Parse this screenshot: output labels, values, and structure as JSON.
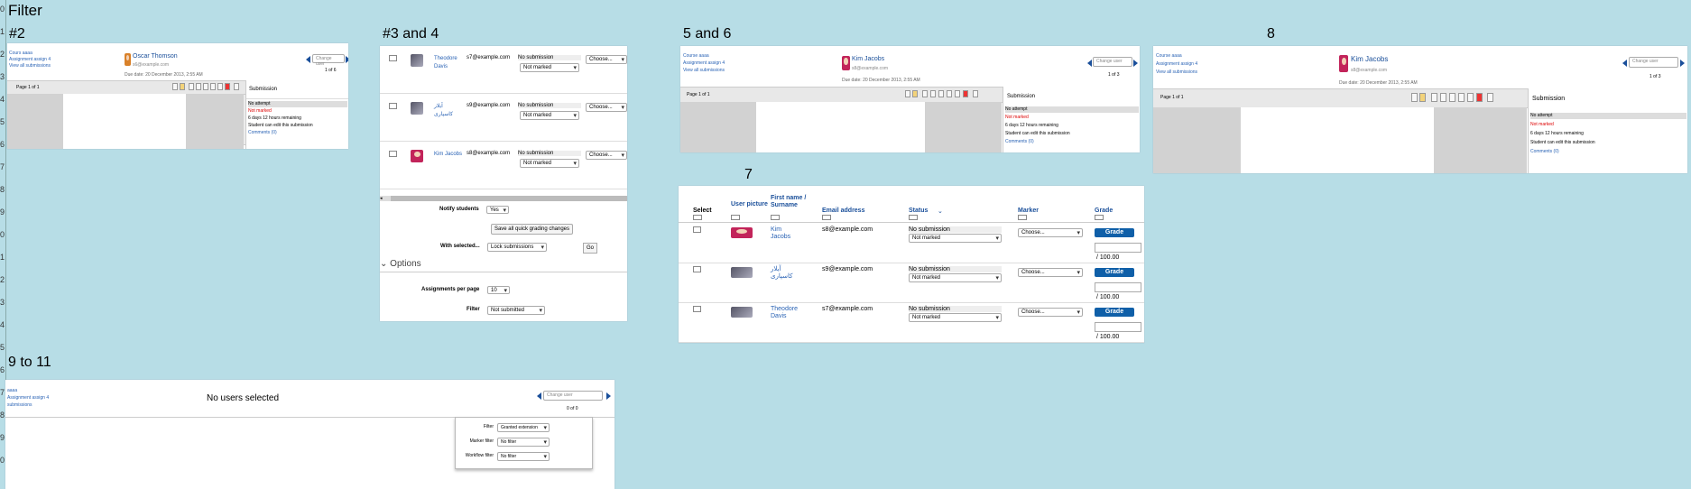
{
  "title": "Filter",
  "labels": {
    "p2": "#2",
    "p34": "#3 and 4",
    "p56": "5 and 6",
    "p8": "8",
    "p7": "7",
    "p911": "9 to 11"
  },
  "gutter_numbers": [
    "0",
    "1",
    "2",
    "3",
    "4",
    "5",
    "6",
    "7",
    "8",
    "9",
    "0",
    "1",
    "2",
    "3",
    "4",
    "5",
    "6",
    "7",
    "8",
    "9",
    "0"
  ],
  "grader_small": {
    "back_links": [
      "Cours aaaa",
      "Assignment assign 4",
      "View all submissions"
    ],
    "user_name": "Oscar Thomson",
    "user_email": "s6@example.com",
    "due": "Due date: 20 December 2013, 2:55 AM",
    "change_user": "Change user",
    "count": "1 of 6",
    "page": "Page 1 of 1",
    "submission_title": "Submission",
    "status": [
      "No attempt",
      "Not marked",
      "6 days 12 hours remaining",
      "Student can edit this submission",
      "Comments (0)"
    ]
  },
  "grader_kim": {
    "back_links": [
      "Course aaaa",
      "Assignment assign 4",
      "View all submissions"
    ],
    "user_name": "Kim Jacobs",
    "user_email": "s8@example.com",
    "due": "Due date: 20 December 2013, 2:55 AM",
    "change_user": "Change user",
    "count": "1 of 3",
    "page": "Page 1 of 1",
    "submission_title": "Submission",
    "status": [
      "No attempt",
      "Not marked",
      "6 days 12 hours remaining",
      "Student can edit this submission",
      "Comments (0)"
    ]
  },
  "table34": {
    "rows": [
      {
        "name": "Theodore Davis",
        "email": "s7@example.com",
        "status": "No submission",
        "grading": "Not marked",
        "marker": "Choose..."
      },
      {
        "name": "آیلار کاسپاری",
        "email": "s9@example.com",
        "status": "No submission",
        "grading": "Not marked",
        "marker": "Choose..."
      },
      {
        "name": "Kim Jacobs",
        "email": "s8@example.com",
        "status": "No submission",
        "grading": "Not marked",
        "marker": "Choose..."
      }
    ],
    "notify_label": "Notify students",
    "notify_value": "Yes",
    "save_button": "Save all quick grading changes",
    "with_selected_label": "With selected...",
    "with_selected_value": "Lock submissions",
    "go_button": "Go",
    "options_title": "Options",
    "per_page_label": "Assignments per page",
    "per_page_value": "10",
    "filter_label": "Filter",
    "filter_value": "Not submitted"
  },
  "table7": {
    "headers": [
      "Select",
      "User picture",
      "First name / Surname",
      "Email address",
      "Status",
      "Marker",
      "Grade"
    ],
    "rows": [
      {
        "name": "Kim Jacobs",
        "email": "s8@example.com",
        "status": "No submission",
        "grading": "Not marked",
        "marker": "Choose...",
        "grade_btn": "Grade",
        "outof": "/ 100.00"
      },
      {
        "name": "آیلار کاسپاری",
        "email": "s9@example.com",
        "status": "No submission",
        "grading": "Not marked",
        "marker": "Choose...",
        "grade_btn": "Grade",
        "outof": "/ 100.00"
      },
      {
        "name": "Theodore Davis",
        "email": "s7@example.com",
        "status": "No submission",
        "grading": "Not marked",
        "marker": "Choose...",
        "grade_btn": "Grade",
        "outof": "/ 100.00"
      }
    ]
  },
  "grader_none": {
    "back_links": [
      "aaaa",
      "Assignment assign 4",
      "submissions"
    ],
    "heading": "No users selected",
    "change_user": "Change user",
    "count": "0 of 0",
    "filters": [
      {
        "label": "Filter",
        "value": "Granted extension"
      },
      {
        "label": "Marker filter",
        "value": "No filter"
      },
      {
        "label": "Workflow filter",
        "value": "No filter"
      }
    ]
  }
}
